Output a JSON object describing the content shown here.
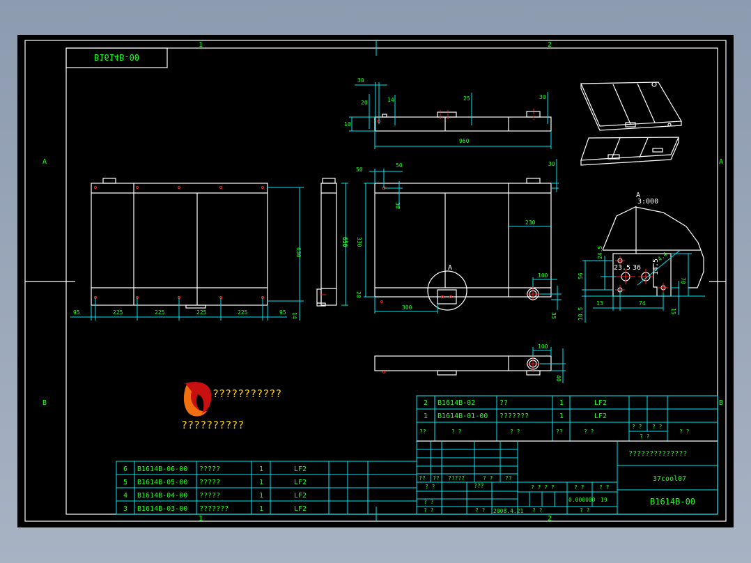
{
  "drawing": {
    "mirrored_code": "B1614B-00",
    "zones": {
      "top_1": "1",
      "top_2": "2",
      "bottom_1": "1",
      "bottom_2": "2",
      "left_A": "A",
      "left_B": "B",
      "right_A": "A",
      "right_B": "B"
    },
    "front_view": {
      "height": "630",
      "bottom": [
        "95",
        "225",
        "225",
        "225",
        "225",
        "95"
      ],
      "small": "14"
    },
    "side_view": {
      "height": "650"
    },
    "top_view": {
      "d1": "30",
      "d2": "20",
      "d3": "14",
      "d4": "10",
      "d5": "25",
      "d6": "30",
      "length": "960"
    },
    "main_view": {
      "d1": "50",
      "d2": "50",
      "d3": "30",
      "d4": "30",
      "height": "650",
      "inner": "330",
      "d5": "20",
      "bottom": "300",
      "right": "230",
      "d6": "100",
      "d7": "35",
      "detail_label": "A"
    },
    "bottom_view": {
      "d1": "100",
      "d2": "40"
    },
    "detail": {
      "label": "A",
      "scale": "3:000",
      "d1": "23.5",
      "d2": "36",
      "d3": "14.5",
      "d4": "24.5",
      "d5": "56",
      "d6": "70",
      "d7": "13",
      "d8": "74",
      "d9": "10.5",
      "d10": "15",
      "d11": "4.4"
    },
    "logo": {
      "line1": "???????????",
      "line2": "??????????"
    }
  },
  "parts_upper": [
    {
      "no": "2",
      "code": "B1614B-02",
      "name": "??",
      "qty": "1",
      "material": "LF2"
    },
    {
      "no": "1",
      "code": "B1614B-01-00",
      "name": "???????",
      "qty": "1",
      "material": "LF2"
    }
  ],
  "parts_upper_header": [
    "??",
    "? ?",
    "? ?",
    "??",
    "? ?",
    "? ?",
    "? ?",
    "? ?",
    "? ?"
  ],
  "parts_lower": [
    {
      "no": "6",
      "code": "B1614B-06-00",
      "name": "?????",
      "qty": "1",
      "material": "LF2"
    },
    {
      "no": "5",
      "code": "B1614B-05-00",
      "name": "?????",
      "qty": "1",
      "material": "LF2"
    },
    {
      "no": "4",
      "code": "B1614B-04-00",
      "name": "?????",
      "qty": "1",
      "material": "LF2"
    },
    {
      "no": "3",
      "code": "B1614B-03-00",
      "name": "???????",
      "qty": "1",
      "material": "LF2"
    }
  ],
  "title_block": {
    "company": "??????????????",
    "drawing_name": "37cool07",
    "drawing_code": "B1614B-00",
    "sign_row": [
      "??",
      "??",
      "?????",
      "? ?",
      "??"
    ],
    "r1": "? ?",
    "r2": "???",
    "r3": "? ?",
    "r4": "? ?",
    "r5": "? ?",
    "date": "2008.4.21",
    "stage": "? ? ? ?",
    "weight_label": "? ?",
    "scale_label": "? ?",
    "weight": "0.000000",
    "scale": "19",
    "sheet1": "?   ?",
    "sheet2": "?   ?"
  }
}
